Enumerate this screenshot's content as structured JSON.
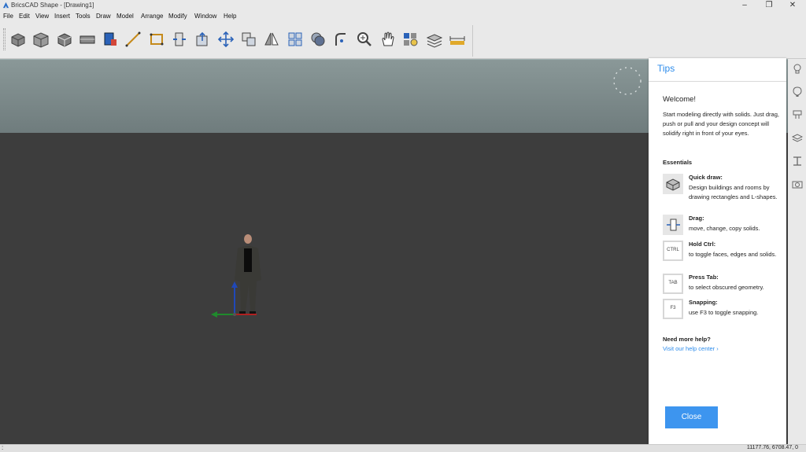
{
  "window": {
    "title": "BricsCAD Shape - [Drawing1]",
    "controls": {
      "minimize": "–",
      "maximize": "❐",
      "close": "✕"
    }
  },
  "menu": [
    "File",
    "Edit",
    "View",
    "Insert",
    "Tools",
    "Draw",
    "Model",
    "Arrange",
    "Modify",
    "Window",
    "Help"
  ],
  "toolbar": {
    "tools": [
      "box-tool-icon",
      "quick-draw-icon",
      "solid-icon",
      "wall-icon",
      "component-icon",
      "line-icon",
      "rectangle-icon",
      "push-pull-icon",
      "extrude-icon",
      "move-icon",
      "copy-icon",
      "mirror-icon",
      "array-icon",
      "union-icon",
      "fillet-icon",
      "zoom-icon",
      "pan-icon",
      "materials-icon",
      "layers-icon",
      "dimension-icon"
    ]
  },
  "sidebar": {
    "icons": [
      "lightbulb-icon",
      "hot-air-balloon-icon",
      "component-library-icon",
      "layers-icon",
      "section-icon",
      "camera-icon"
    ]
  },
  "statusbar": {
    "cursor": ":",
    "coords": "11177.76, 6708.47, 0"
  },
  "tips": {
    "title": "Tips",
    "welcome_title": "Welcome!",
    "welcome_body": "Start modeling directly with solids. Just drag, push or pull and your design concept will solidify right in front of your eyes.",
    "essentials_title": "Essentials",
    "items": [
      {
        "icon": "quick-draw-icon",
        "heading": "Quick draw:",
        "desc": "Design buildings and rooms by drawing rectangles and L-shapes."
      },
      {
        "icon": "drag-icon",
        "heading": "Drag:",
        "desc": "move, change, copy solids."
      },
      {
        "key": "CTRL",
        "heading": "Hold Ctrl:",
        "desc": "to toggle faces, edges and solids."
      },
      {
        "key": "TAB",
        "heading": "Press Tab:",
        "desc": "to select obscured geometry."
      },
      {
        "key": "F3",
        "heading": "Snapping:",
        "desc": "use F3 to toggle snapping."
      }
    ],
    "help_heading": "Need more help?",
    "help_link": "Visit our help center ›",
    "close_label": "Close",
    "accent": "#2d8ceb",
    "button_color": "#3d95ef"
  }
}
